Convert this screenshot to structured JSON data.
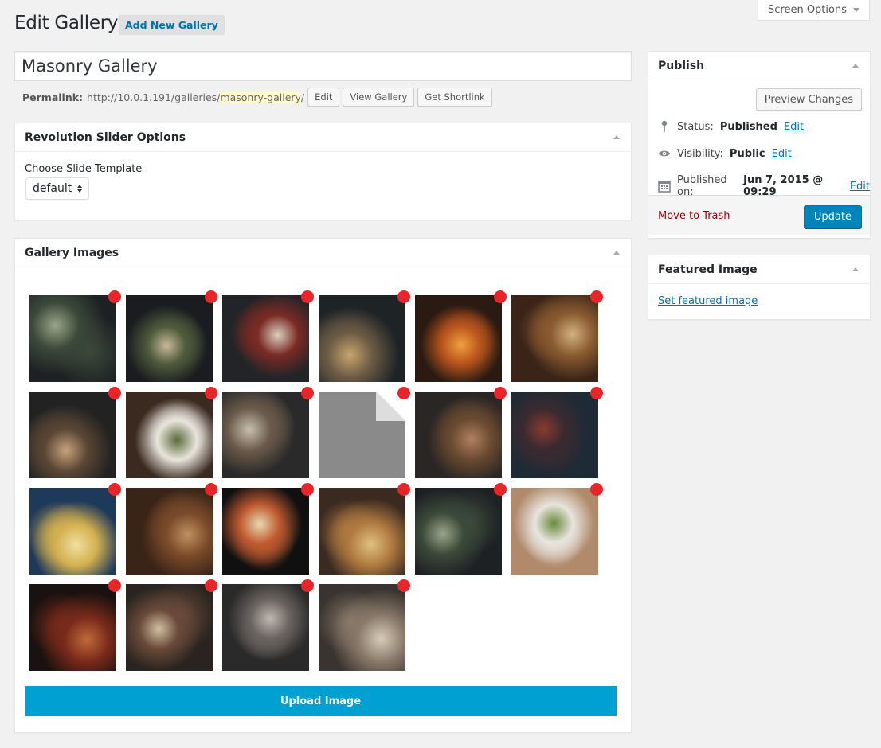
{
  "screen_options": {
    "label": "Screen Options"
  },
  "header": {
    "title": "Edit Gallery",
    "add_new": "Add New Gallery"
  },
  "post": {
    "title": "Masonry Gallery",
    "permalink_label": "Permalink:",
    "permalink_base": "http://10.0.1.191/galleries/",
    "permalink_slug": "masonry-gallery",
    "permalink_trail": "/",
    "edit_btn": "Edit",
    "view_btn": "View Gallery",
    "shortlink_btn": "Get Shortlink"
  },
  "slider_box": {
    "title": "Revolution Slider Options",
    "label": "Choose Slide Template",
    "selected": "default"
  },
  "gallery_box": {
    "title": "Gallery Images",
    "upload_label": "Upload Image",
    "images": [
      {
        "name": "black-pasta-bowl",
        "colors": [
          "#1e2124",
          "#3b4a3a",
          "#9aa58a"
        ]
      },
      {
        "name": "dark-plate-greens",
        "colors": [
          "#1a1c1f",
          "#4e5a3c",
          "#c8b89a"
        ]
      },
      {
        "name": "squid-ink-noodles",
        "colors": [
          "#222428",
          "#7a2a24",
          "#d9d0c0"
        ]
      },
      {
        "name": "restaurant-interior-lights",
        "colors": [
          "#1e2326",
          "#6b5a44",
          "#c9a56d"
        ]
      },
      {
        "name": "grill-flames",
        "colors": [
          "#2a1a12",
          "#b9541c",
          "#f0a040"
        ]
      },
      {
        "name": "ramen-bowl",
        "colors": [
          "#3a2418",
          "#8a5a30",
          "#d4b080"
        ]
      },
      {
        "name": "bread-wheat",
        "colors": [
          "#222222",
          "#5a4634",
          "#c6a27c"
        ]
      },
      {
        "name": "noodle-plate-white",
        "colors": [
          "#3a2a20",
          "#e8e4dc",
          "#5a6a3a"
        ]
      },
      {
        "name": "chef-plating",
        "colors": [
          "#2a2a2a",
          "#6a5a4a",
          "#c8c0b0"
        ]
      },
      {
        "name": "placeholder-file",
        "colors": [
          "#8a8a8a",
          "#8a8a8a",
          "#8a8a8a"
        ]
      },
      {
        "name": "pretzel-spread",
        "colors": [
          "#2a2624",
          "#6a4a30",
          "#b08060"
        ]
      },
      {
        "name": "dark-berries",
        "colors": [
          "#1e2a36",
          "#3a2a30",
          "#8a3a30"
        ]
      },
      {
        "name": "ravioli-bowl",
        "colors": [
          "#1e3a5a",
          "#d4b050",
          "#f0e0a0"
        ]
      },
      {
        "name": "roast-chicken-pan",
        "colors": [
          "#3a2418",
          "#7a4a2a",
          "#c09060"
        ]
      },
      {
        "name": "spaghetti-tomato",
        "colors": [
          "#101010",
          "#c05a30",
          "#e8d8b0"
        ]
      },
      {
        "name": "plated-shrimp",
        "colors": [
          "#3a2a20",
          "#b07a40",
          "#e0c080"
        ]
      },
      {
        "name": "black-pasta-bowl-2",
        "colors": [
          "#1e2124",
          "#3b4a3a",
          "#9aa58a"
        ]
      },
      {
        "name": "salad-plate",
        "colors": [
          "#b08a6a",
          "#e8e4de",
          "#6a8a3a"
        ]
      },
      {
        "name": "whisky-glass",
        "colors": [
          "#1a1210",
          "#7a2a1a",
          "#c06a3a"
        ]
      },
      {
        "name": "meat-dish-dark",
        "colors": [
          "#2a2420",
          "#6a4a3a",
          "#d0c0a0"
        ]
      },
      {
        "name": "dining-room-chairs",
        "colors": [
          "#2a2a2a",
          "#6a6460",
          "#c0b8b0"
        ]
      },
      {
        "name": "restaurant-hall",
        "colors": [
          "#3a3430",
          "#8a7a6a",
          "#d8ccb8"
        ]
      }
    ]
  },
  "publish_box": {
    "title": "Publish",
    "preview_btn": "Preview Changes",
    "status_label": "Status:",
    "status_value": "Published",
    "visibility_label": "Visibility:",
    "visibility_value": "Public",
    "published_label": "Published on:",
    "published_value": "Jun 7, 2015 @ 09:29",
    "edit_link": "Edit",
    "trash": "Move to Trash",
    "update": "Update"
  },
  "featured_box": {
    "title": "Featured Image",
    "link": "Set featured image"
  },
  "colors": {
    "accent_blue": "#00a0d2",
    "delete_red": "#e8262a",
    "link": "#0073aa",
    "trash": "#aa0000"
  }
}
